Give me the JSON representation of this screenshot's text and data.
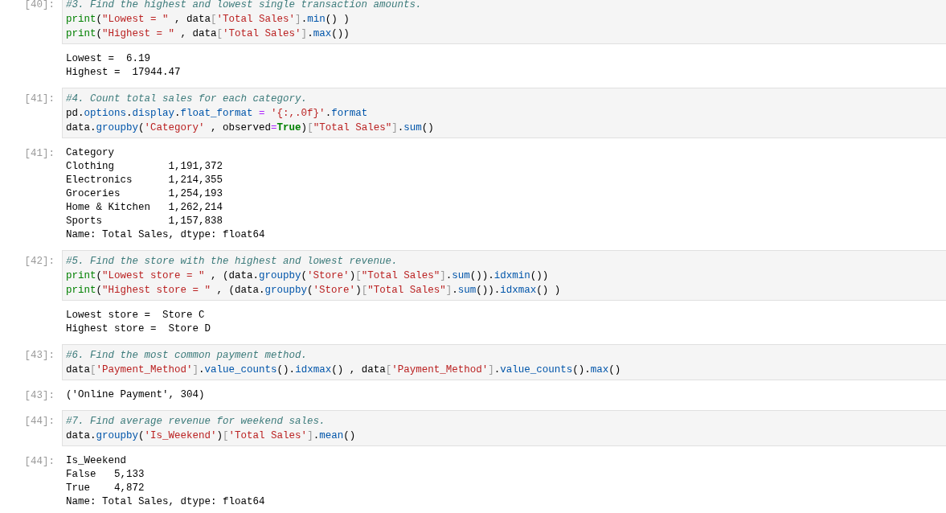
{
  "cells": [
    {
      "prompt": "[40]:",
      "code": [
        [
          {
            "kind": "comment",
            "text": "#3. Find the highest and lowest single transaction amounts."
          }
        ],
        [
          {
            "kind": "builtin",
            "text": "print"
          },
          {
            "kind": "plain",
            "text": "("
          },
          {
            "kind": "string",
            "text": "\"Lowest = \""
          },
          {
            "kind": "plain",
            "text": " , data"
          },
          {
            "kind": "bracket",
            "text": "["
          },
          {
            "kind": "string",
            "text": "'Total Sales'"
          },
          {
            "kind": "bracket",
            "text": "]"
          },
          {
            "kind": "plain",
            "text": "."
          },
          {
            "kind": "attr",
            "text": "min"
          },
          {
            "kind": "plain",
            "text": "() )"
          }
        ],
        [
          {
            "kind": "builtin",
            "text": "print"
          },
          {
            "kind": "plain",
            "text": "("
          },
          {
            "kind": "string",
            "text": "\"Highest = \""
          },
          {
            "kind": "plain",
            "text": " , data"
          },
          {
            "kind": "bracket",
            "text": "["
          },
          {
            "kind": "string",
            "text": "'Total Sales'"
          },
          {
            "kind": "bracket",
            "text": "]"
          },
          {
            "kind": "plain",
            "text": "."
          },
          {
            "kind": "attr",
            "text": "max"
          },
          {
            "kind": "plain",
            "text": "())"
          }
        ]
      ],
      "output": {
        "lines": [
          "Lowest =  6.19",
          "Highest =  17944.47"
        ]
      }
    },
    {
      "prompt": "[41]:",
      "code": [
        [
          {
            "kind": "comment",
            "text": "#4. Count total sales for each category."
          }
        ],
        [
          {
            "kind": "plain",
            "text": "pd."
          },
          {
            "kind": "attr",
            "text": "options"
          },
          {
            "kind": "plain",
            "text": "."
          },
          {
            "kind": "attr",
            "text": "display"
          },
          {
            "kind": "plain",
            "text": "."
          },
          {
            "kind": "attr",
            "text": "float_format"
          },
          {
            "kind": "operator",
            "text": " = "
          },
          {
            "kind": "string",
            "text": "'{:,.0f}'"
          },
          {
            "kind": "plain",
            "text": "."
          },
          {
            "kind": "attr",
            "text": "format"
          }
        ],
        [
          {
            "kind": "plain",
            "text": "data."
          },
          {
            "kind": "attr",
            "text": "groupby"
          },
          {
            "kind": "plain",
            "text": "("
          },
          {
            "kind": "string",
            "text": "'Category'"
          },
          {
            "kind": "plain",
            "text": " , observed"
          },
          {
            "kind": "operator",
            "text": "="
          },
          {
            "kind": "keyword",
            "text": "True"
          },
          {
            "kind": "plain",
            "text": ")"
          },
          {
            "kind": "bracket",
            "text": "["
          },
          {
            "kind": "string",
            "text": "\"Total Sales\""
          },
          {
            "kind": "bracket",
            "text": "]"
          },
          {
            "kind": "plain",
            "text": "."
          },
          {
            "kind": "attr",
            "text": "sum"
          },
          {
            "kind": "plain",
            "text": "()"
          }
        ]
      ],
      "output": {
        "prompt": "[41]:",
        "lines": [
          "Category",
          "Clothing         1,191,372",
          "Electronics      1,214,355",
          "Groceries        1,254,193",
          "Home & Kitchen   1,262,214",
          "Sports           1,157,838",
          "Name: Total Sales, dtype: float64"
        ]
      }
    },
    {
      "prompt": "[42]:",
      "code": [
        [
          {
            "kind": "comment",
            "text": "#5. Find the store with the highest and lowest revenue."
          }
        ],
        [
          {
            "kind": "builtin",
            "text": "print"
          },
          {
            "kind": "plain",
            "text": "("
          },
          {
            "kind": "string",
            "text": "\"Lowest store = \""
          },
          {
            "kind": "plain",
            "text": " , (data."
          },
          {
            "kind": "attr",
            "text": "groupby"
          },
          {
            "kind": "plain",
            "text": "("
          },
          {
            "kind": "string",
            "text": "'Store'"
          },
          {
            "kind": "plain",
            "text": ")"
          },
          {
            "kind": "bracket",
            "text": "["
          },
          {
            "kind": "string",
            "text": "\"Total Sales\""
          },
          {
            "kind": "bracket",
            "text": "]"
          },
          {
            "kind": "plain",
            "text": "."
          },
          {
            "kind": "attr",
            "text": "sum"
          },
          {
            "kind": "plain",
            "text": "())."
          },
          {
            "kind": "attr",
            "text": "idxmin"
          },
          {
            "kind": "plain",
            "text": "())"
          }
        ],
        [
          {
            "kind": "builtin",
            "text": "print"
          },
          {
            "kind": "plain",
            "text": "("
          },
          {
            "kind": "string",
            "text": "\"Highest store = \""
          },
          {
            "kind": "plain",
            "text": " , (data."
          },
          {
            "kind": "attr",
            "text": "groupby"
          },
          {
            "kind": "plain",
            "text": "("
          },
          {
            "kind": "string",
            "text": "'Store'"
          },
          {
            "kind": "plain",
            "text": ")"
          },
          {
            "kind": "bracket",
            "text": "["
          },
          {
            "kind": "string",
            "text": "\"Total Sales\""
          },
          {
            "kind": "bracket",
            "text": "]"
          },
          {
            "kind": "plain",
            "text": "."
          },
          {
            "kind": "attr",
            "text": "sum"
          },
          {
            "kind": "plain",
            "text": "())."
          },
          {
            "kind": "attr",
            "text": "idxmax"
          },
          {
            "kind": "plain",
            "text": "() )"
          }
        ]
      ],
      "output": {
        "lines": [
          "Lowest store =  Store C",
          "Highest store =  Store D"
        ]
      }
    },
    {
      "prompt": "[43]:",
      "code": [
        [
          {
            "kind": "comment",
            "text": "#6. Find the most common payment method."
          }
        ],
        [
          {
            "kind": "plain",
            "text": "data"
          },
          {
            "kind": "bracket",
            "text": "["
          },
          {
            "kind": "string",
            "text": "'Payment_Method'"
          },
          {
            "kind": "bracket",
            "text": "]"
          },
          {
            "kind": "plain",
            "text": "."
          },
          {
            "kind": "attr",
            "text": "value_counts"
          },
          {
            "kind": "plain",
            "text": "()."
          },
          {
            "kind": "attr",
            "text": "idxmax"
          },
          {
            "kind": "plain",
            "text": "() , data"
          },
          {
            "kind": "bracket",
            "text": "["
          },
          {
            "kind": "string",
            "text": "'Payment_Method'"
          },
          {
            "kind": "bracket",
            "text": "]"
          },
          {
            "kind": "plain",
            "text": "."
          },
          {
            "kind": "attr",
            "text": "value_counts"
          },
          {
            "kind": "plain",
            "text": "()."
          },
          {
            "kind": "attr",
            "text": "max"
          },
          {
            "kind": "plain",
            "text": "()"
          }
        ]
      ],
      "output": {
        "prompt": "[43]:",
        "lines": [
          "('Online Payment', 304)"
        ]
      }
    },
    {
      "prompt": "[44]:",
      "code": [
        [
          {
            "kind": "comment",
            "text": "#7. Find average revenue for weekend sales."
          }
        ],
        [
          {
            "kind": "plain",
            "text": "data."
          },
          {
            "kind": "attr",
            "text": "groupby"
          },
          {
            "kind": "plain",
            "text": "("
          },
          {
            "kind": "string",
            "text": "'Is_Weekend'"
          },
          {
            "kind": "plain",
            "text": ")"
          },
          {
            "kind": "bracket",
            "text": "["
          },
          {
            "kind": "string",
            "text": "'Total Sales'"
          },
          {
            "kind": "bracket",
            "text": "]"
          },
          {
            "kind": "plain",
            "text": "."
          },
          {
            "kind": "attr",
            "text": "mean"
          },
          {
            "kind": "plain",
            "text": "()"
          }
        ]
      ],
      "output": {
        "prompt": "[44]:",
        "lines": [
          "Is_Weekend",
          "False   5,133",
          "True    4,872",
          "Name: Total Sales, dtype: float64"
        ]
      }
    }
  ]
}
